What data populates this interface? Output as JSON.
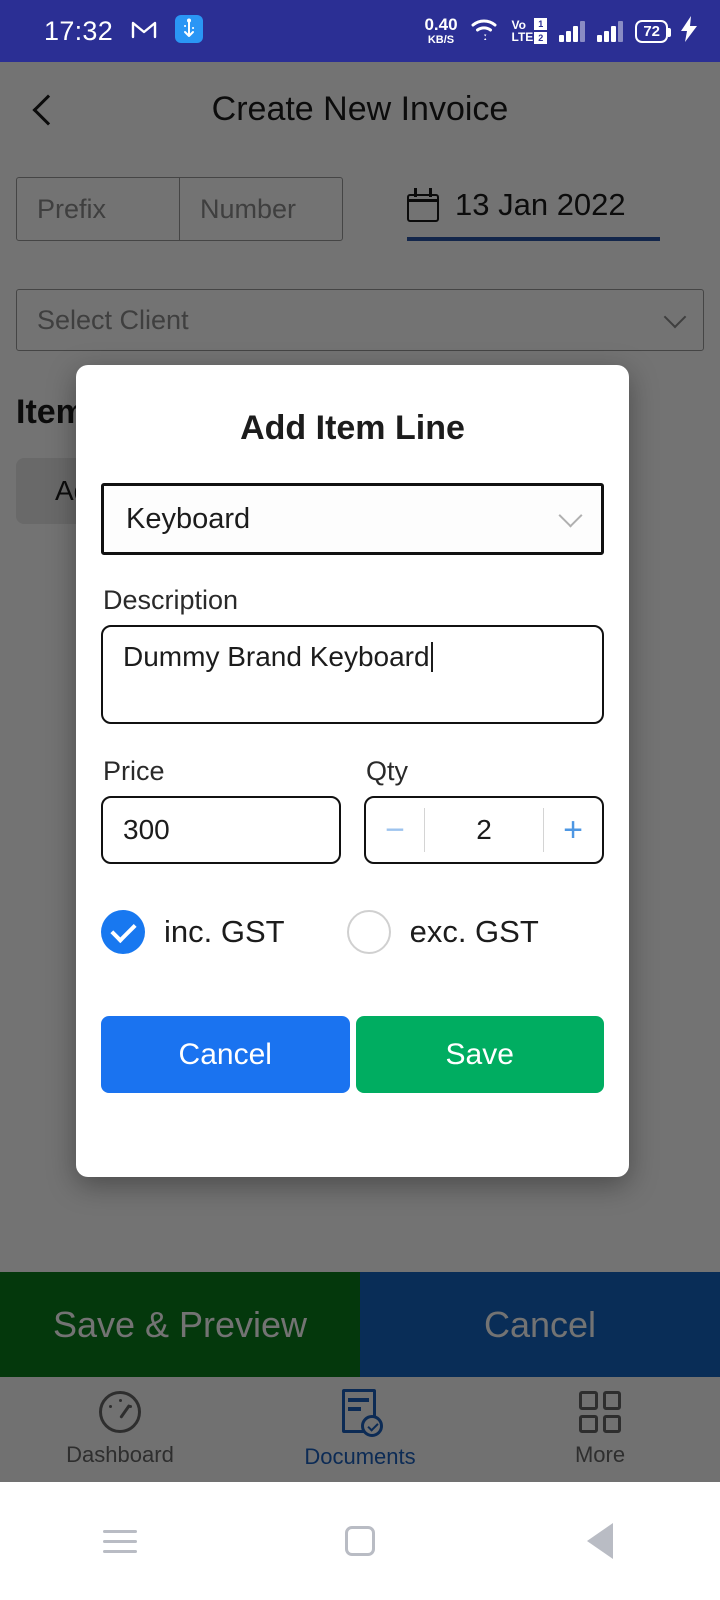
{
  "statusbar": {
    "time": "17:32",
    "mail_icon": "gmail-icon",
    "usb_icon": "usb-icon",
    "net_speed_value": "0.40",
    "net_speed_unit": "KB/S",
    "wifi_icon": "wifi-icon",
    "volte_top": "Vo",
    "volte_bottom": "LTE",
    "sim1_badge": "1",
    "sim2_badge": "2",
    "battery": "72",
    "charging_icon": "lightning-bolt-icon",
    "background": "#2b2f94"
  },
  "appbar": {
    "back_icon": "chevron-left-icon",
    "title": "Create New Invoice"
  },
  "invoice_number": {
    "prefix_placeholder": "Prefix",
    "number_placeholder": "Number"
  },
  "invoice_date": {
    "calendar_icon": "calendar-icon",
    "value": "13 Jan 2022",
    "underline_color": "#2b55a6"
  },
  "client": {
    "placeholder": "Select Client",
    "chevron_icon": "chevron-down-icon"
  },
  "items_section": {
    "heading": "Items",
    "add_button_label": "Add Item"
  },
  "action_bar": {
    "save_preview_label": "Save & Preview",
    "save_preview_color": "#0a7d1b",
    "cancel_label": "Cancel",
    "cancel_color": "#1565c0"
  },
  "bottom_nav": {
    "items": [
      {
        "label": "Dashboard",
        "icon": "gauge-icon",
        "active": false
      },
      {
        "label": "Documents",
        "icon": "document-check-icon",
        "active": true
      },
      {
        "label": "More",
        "icon": "grid-four-icon",
        "active": false
      }
    ],
    "active_color": "#1b5fbd",
    "inactive_color": "#666666"
  },
  "dialog": {
    "title": "Add Item Line",
    "item_select": {
      "value": "Keyboard",
      "chevron_icon": "chevron-down-icon"
    },
    "description": {
      "label": "Description",
      "value": "Dummy Brand Keyboard"
    },
    "price": {
      "label": "Price",
      "value": "300"
    },
    "qty": {
      "label": "Qty",
      "value": "2",
      "minus_label": "−",
      "plus_label": "+",
      "minus_color": "#9dc3ee",
      "plus_color": "#4e97e3"
    },
    "gst": {
      "inclusive_label": "inc. GST",
      "exclusive_label": "exc. GST",
      "selected": "inc. GST",
      "selected_color": "#1878f0"
    },
    "buttons": {
      "cancel_label": "Cancel",
      "cancel_color": "#1a73f0",
      "save_label": "Save",
      "save_color": "#00ad61"
    }
  },
  "android_nav": {
    "recents_icon": "hamburger-icon",
    "home_icon": "home-square-icon",
    "back_icon": "back-triangle-icon"
  }
}
